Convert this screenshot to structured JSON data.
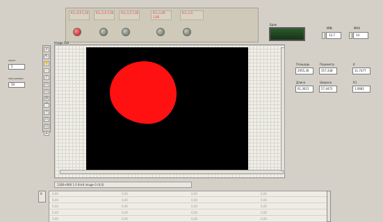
{
  "led_panel": {
    "indicators": [
      {
        "label": "К1=0,0\n1,20",
        "state": "on",
        "color": "#d83030"
      },
      {
        "label": "К1=1,6\n1,06",
        "state": "off",
        "color": "#7b8479"
      },
      {
        "label": "К1=1,5\n1,06",
        "state": "off",
        "color": "#7b8479"
      },
      {
        "label": "К1=1,06\n1,06",
        "state": "off",
        "color": "#7b8479"
      },
      {
        "label": "К1=1,0",
        "state": "off",
        "color": "#7b8479"
      }
    ]
  },
  "brightness": {
    "label": "Брак"
  },
  "min_max": {
    "min_label": "MIN",
    "min_value": "12,7",
    "max_label": "MAX",
    "max_value": "14"
  },
  "left_controls": {
    "field1_label": "порог",
    "field1_value": "5",
    "field2_label": "мин.размер",
    "field2_value": "50"
  },
  "image_out": {
    "title": "Image Out",
    "status_text": "1280×960 1.0 8-bit image 0    (0,0)"
  },
  "measurements": {
    "area_label": "Площадь",
    "area_value": "2955,36",
    "perimeter_label": "Периметр",
    "perimeter_value": "357,338",
    "k_label": "K",
    "k_value": "11,7477",
    "length_label": "Длина",
    "length_value": "61,3615",
    "width_label": "Ширина",
    "width_value": "57,4472",
    "k1_label": "К1",
    "k1_value": "1,0681"
  },
  "table": {
    "index": "0",
    "rows": [
      [
        "0,00",
        "0,00",
        "0,00",
        "0,00"
      ],
      [
        "0,00",
        "0,00",
        "0,00",
        "0,00"
      ],
      [
        "0,00",
        "0,00",
        "0,00",
        "0,00"
      ],
      [
        "0,00",
        "0,00",
        "0,00",
        "0,00"
      ],
      [
        "0,00",
        "0,00",
        "0,00",
        "0,00"
      ]
    ]
  },
  "colors": {
    "background": "#d4d0c8",
    "blob": "#ff1111",
    "image_bg": "#000000",
    "brightness_indicator": "#1f451f"
  }
}
